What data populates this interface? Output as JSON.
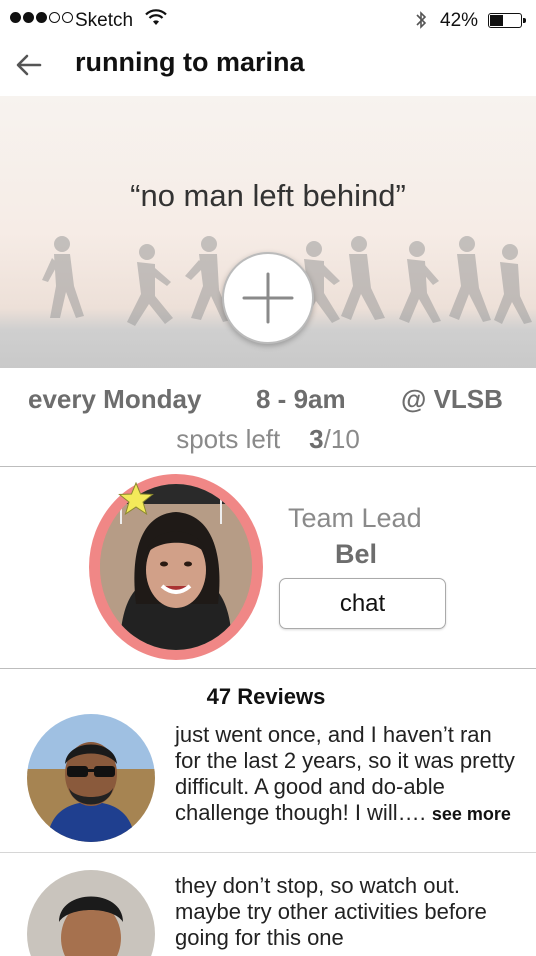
{
  "status_bar": {
    "carrier": "Sketch",
    "battery": "42%",
    "battery_level": 0.42,
    "icons": [
      "signal-dots",
      "wifi-icon",
      "bluetooth-icon",
      "battery-icon"
    ]
  },
  "header": {
    "back_icon": "arrow-left-icon",
    "title": "running to marina"
  },
  "hero": {
    "quote": "“no man left behind”",
    "join_icon": "plus-icon"
  },
  "schedule": {
    "day": "every Monday",
    "time": "8 - 9am",
    "location": "@ VLSB",
    "spots_label": "spots left",
    "spots_taken": "3",
    "spots_total": "/10"
  },
  "leader": {
    "role": "Team Lead",
    "name": "Bel",
    "chat_label": "chat",
    "badge_icon": "star-icon",
    "ring_color": "#f08786"
  },
  "reviews": {
    "title": "47 Reviews",
    "items": [
      {
        "text": "just went once, and I haven’t ran for the last 2 years, so it was pretty difficult. A good and do-able challenge though! I will….",
        "more": "see more"
      },
      {
        "text": "they don’t stop, so watch out. maybe try other activities before going for this one",
        "more": ""
      }
    ]
  }
}
